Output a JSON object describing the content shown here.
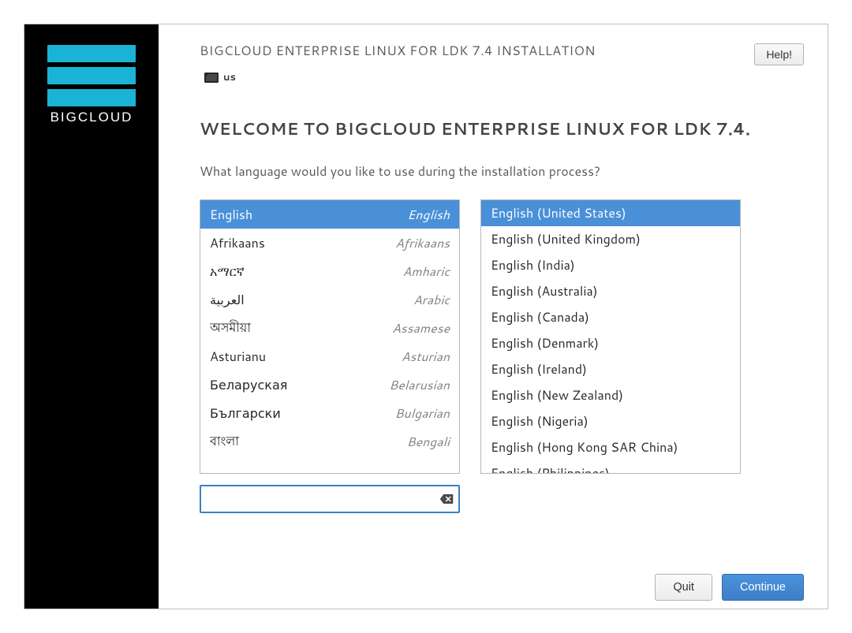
{
  "header": {
    "install_title": "BIGCLOUD ENTERPRISE LINUX FOR LDK 7.4 INSTALLATION",
    "keyboard_layout": "us",
    "help_label": "Help!"
  },
  "sidebar": {
    "brand_name": "BIGCLOUD"
  },
  "content": {
    "welcome_title": "WELCOME TO BIGCLOUD ENTERPRISE LINUX FOR LDK 7.4.",
    "subtitle": "What language would you like to use during the installation process?",
    "search_value": "",
    "search_placeholder": ""
  },
  "languages": [
    {
      "native": "English",
      "english": "English",
      "selected": true
    },
    {
      "native": "Afrikaans",
      "english": "Afrikaans",
      "selected": false
    },
    {
      "native": "አማርኛ",
      "english": "Amharic",
      "selected": false
    },
    {
      "native": "العربية",
      "english": "Arabic",
      "selected": false
    },
    {
      "native": "অসমীয়া",
      "english": "Assamese",
      "selected": false
    },
    {
      "native": "Asturianu",
      "english": "Asturian",
      "selected": false
    },
    {
      "native": "Беларуская",
      "english": "Belarusian",
      "selected": false
    },
    {
      "native": "Български",
      "english": "Bulgarian",
      "selected": false
    },
    {
      "native": "বাংলা",
      "english": "Bengali",
      "selected": false
    }
  ],
  "locales": [
    {
      "label": "English (United States)",
      "selected": true
    },
    {
      "label": "English (United Kingdom)",
      "selected": false
    },
    {
      "label": "English (India)",
      "selected": false
    },
    {
      "label": "English (Australia)",
      "selected": false
    },
    {
      "label": "English (Canada)",
      "selected": false
    },
    {
      "label": "English (Denmark)",
      "selected": false
    },
    {
      "label": "English (Ireland)",
      "selected": false
    },
    {
      "label": "English (New Zealand)",
      "selected": false
    },
    {
      "label": "English (Nigeria)",
      "selected": false
    },
    {
      "label": "English (Hong Kong SAR China)",
      "selected": false
    },
    {
      "label": "English (Philippines)",
      "selected": false
    }
  ],
  "footer": {
    "quit_label": "Quit",
    "continue_label": "Continue"
  }
}
